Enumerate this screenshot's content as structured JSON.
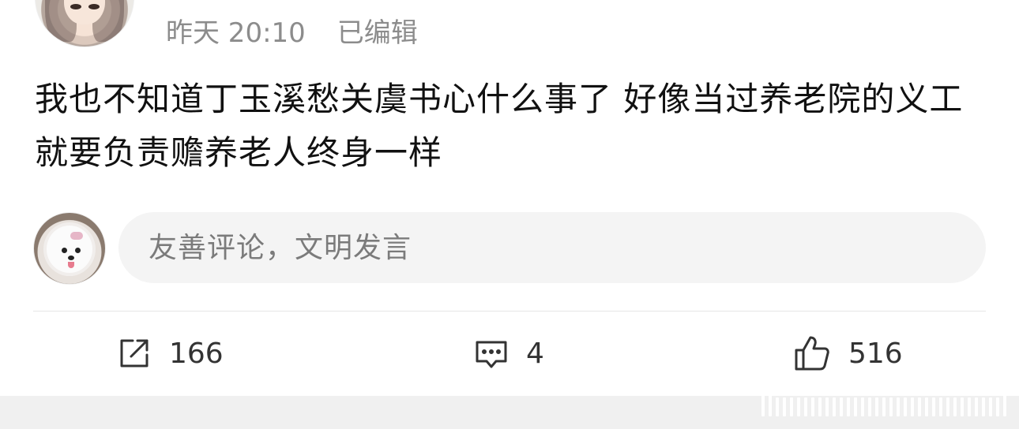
{
  "post": {
    "time": "昨天 20:10",
    "edited_label": "已编辑",
    "text": "我也不知道丁玉溪愁关虞书心什么事了 好像当过养老院的义工就要负责赡养老人终身一样"
  },
  "comment_input": {
    "placeholder": "友善评论，文明发言"
  },
  "actions": {
    "share_count": "166",
    "comment_count": "4",
    "like_count": "516"
  },
  "icons": {
    "share": "share-icon",
    "comment": "comment-icon",
    "like": "thumbs-up-icon"
  },
  "colors": {
    "meta_text": "#8c8c8c",
    "input_bg": "#f4f4f4",
    "divider": "#e6e6e6"
  }
}
